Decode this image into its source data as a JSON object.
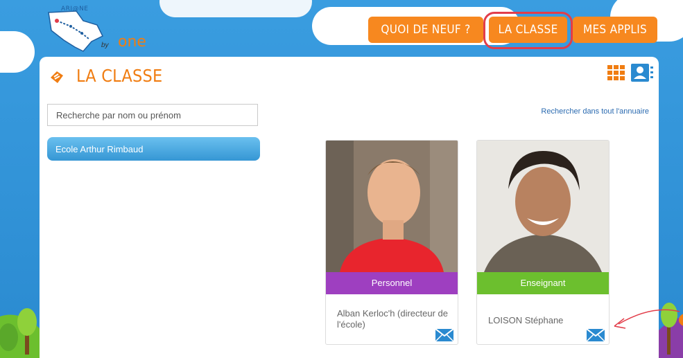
{
  "logo": {
    "tagline": "ARI@NE",
    "by": "by",
    "brand": "one"
  },
  "nav": {
    "items": [
      {
        "label": "QUOI DE NEUF ?"
      },
      {
        "label": "LA CLASSE"
      },
      {
        "label": "MES APPLIS"
      }
    ],
    "active": "LA CLASSE"
  },
  "panel": {
    "title": "LA CLASSE",
    "search_placeholder": "Recherche par nom ou prénom",
    "search_all_link": "Rechercher dans tout l'annuaire",
    "school": "Ecole Arthur Rimbaud"
  },
  "cards": [
    {
      "role": "Personnel",
      "name": "Alban Kerloc'h (directeur de l'école)",
      "role_color": "#9e3fc0"
    },
    {
      "role": "Enseignant",
      "name": "LOISON Stéphane",
      "role_color": "#6cbf2e"
    }
  ],
  "colors": {
    "accent": "#f7881f",
    "highlight": "#e23d4a",
    "link": "#2a6ab0",
    "school_bar": "#3596d4"
  }
}
